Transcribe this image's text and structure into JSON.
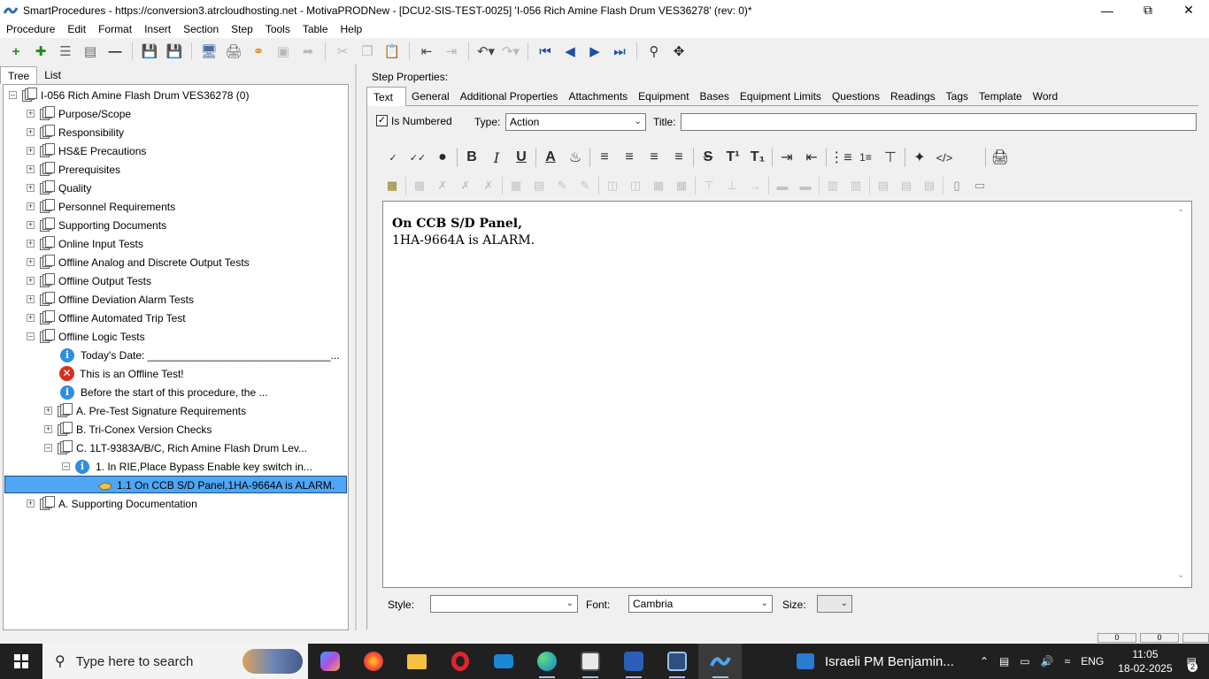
{
  "window": {
    "title": "SmartProcedures - https://conversion3.atrcloudhosting.net - MotivaPRODNew - [DCU2-SIS-TEST-0025] 'I-056 Rich Amine Flash Drum VES36278' (rev: 0)*"
  },
  "menu": [
    "Procedure",
    "Edit",
    "Format",
    "Insert",
    "Section",
    "Step",
    "Tools",
    "Table",
    "Help"
  ],
  "left_tabs": [
    "Tree",
    "List"
  ],
  "tree": {
    "root": "I-056 Rich Amine Flash Drum VES36278 (0)",
    "sections": [
      "Purpose/Scope",
      "Responsibility",
      "HS&E Precautions",
      "Prerequisites",
      "Quality",
      "Personnel Requirements",
      "Supporting Documents",
      "Online Input Tests",
      "Offline Analog and Discrete Output Tests",
      "Offline Output Tests",
      "Offline Deviation Alarm Tests",
      "Offline Automated Trip Test",
      "Offline Logic Tests"
    ],
    "logic_children": {
      "info1": "Today's Date: _______________________________...",
      "warn1": "This is an Offline Test!",
      "info2": "Before the start of this procedure, the ...",
      "subA": "A. Pre-Test Signature Requirements",
      "subB": "B. Tri-Conex Version Checks",
      "subC": "C. 1LT-9383A/B/C, Rich Amine Flash Drum Lev...",
      "step1": "1. In RIE,Place Bypass Enable key switch in...",
      "step11": "1.1 On CCB S/D Panel,1HA-9664A is ALARM."
    },
    "last": "A. Supporting Documentation"
  },
  "step_properties": {
    "label": "Step Properties:",
    "tabs": [
      "Text",
      "General",
      "Additional Properties",
      "Attachments",
      "Equipment",
      "Bases",
      "Equipment Limits",
      "Questions",
      "Readings",
      "Tags",
      "Template",
      "Word"
    ],
    "is_numbered_label": "Is Numbered",
    "is_numbered": true,
    "type_label": "Type:",
    "type_value": "Action",
    "title_label": "Title:",
    "title_value": ""
  },
  "editor": {
    "line1": "On CCB S/D Panel,",
    "line2": "1HA-9664A is ALARM."
  },
  "bottom": {
    "style_label": "Style:",
    "style_value": "",
    "font_label": "Font:",
    "font_value": "Cambria",
    "size_label": "Size:",
    "size_value": ""
  },
  "status": {
    "box1": "0",
    "box2": "0"
  },
  "taskbar": {
    "search_placeholder": "Type here to search",
    "notification": "Israeli PM Benjamin...",
    "lang": "ENG",
    "time": "11:05",
    "date": "18-02-2025",
    "badge": "2"
  }
}
